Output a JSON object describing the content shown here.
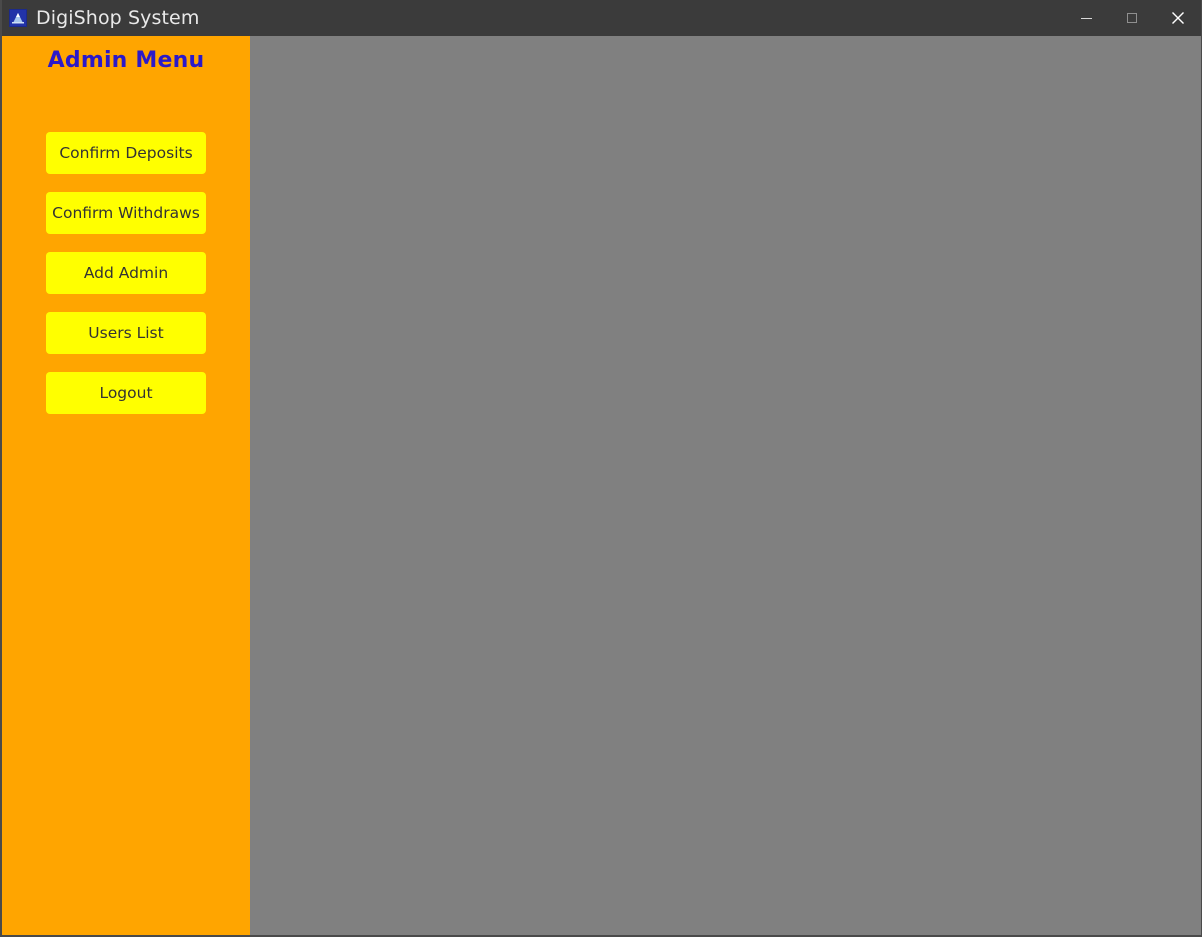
{
  "window": {
    "title": "DigiShop System",
    "app_icon": "mountain-app-icon",
    "controls": {
      "minimize": "minimize-icon",
      "maximize": "maximize-icon",
      "close": "close-icon"
    }
  },
  "sidebar": {
    "heading": "Admin Menu",
    "buttons": [
      {
        "label": "Confirm Deposits"
      },
      {
        "label": "Confirm Withdraws"
      },
      {
        "label": "Add Admin"
      },
      {
        "label": "Users List"
      },
      {
        "label": "Logout"
      }
    ]
  },
  "content": {
    "text": ""
  },
  "colors": {
    "titlebar": "#3b3b3b",
    "sidebar": "#ffa500",
    "button": "#ffff00",
    "button_text": "#333333",
    "heading_text": "#2b19c9",
    "content_background": "#808080",
    "title_text": "#e9e9e9"
  }
}
